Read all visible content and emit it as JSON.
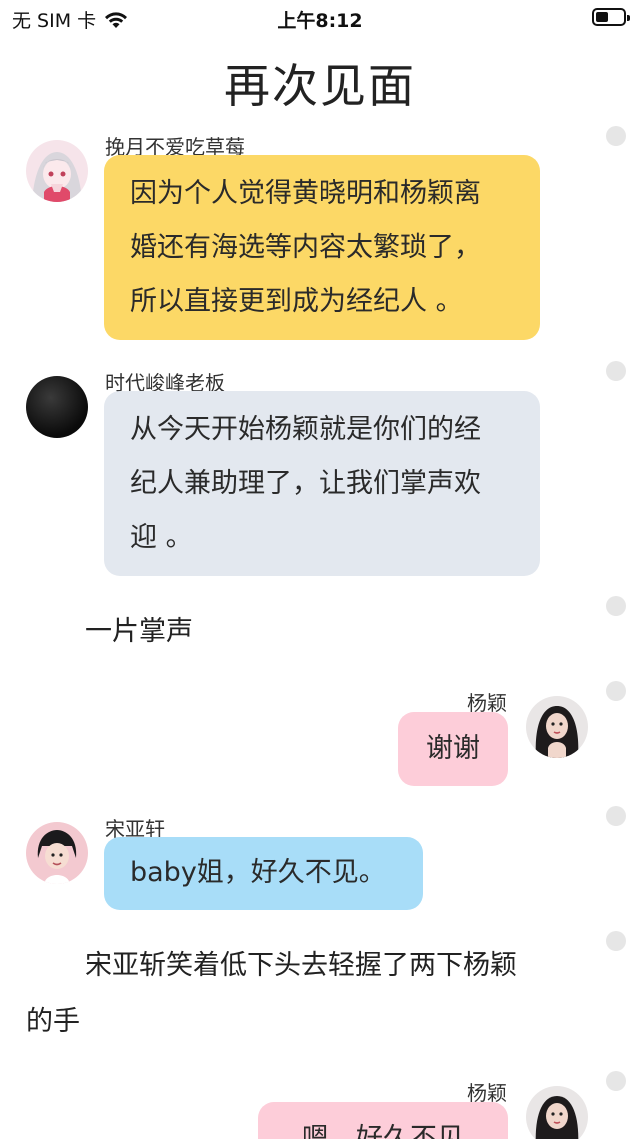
{
  "status_bar": {
    "carrier": "无 SIM 卡",
    "time": "上午8:12",
    "wifi_icon": "wifi-icon",
    "battery_icon": "battery-icon"
  },
  "page": {
    "title": "再次见面"
  },
  "messages": [
    {
      "sender": "挽月不爱吃草莓",
      "avatar": "avatar-anime-girl",
      "text_lines": [
        "因为个人觉得黄晓明和杨颖离",
        "婚还有海选等内容太繁琐了，",
        "所以直接更到成为经纪人 。"
      ],
      "color": "#fcd866",
      "side": "left"
    },
    {
      "sender": "时代峻峰老板",
      "avatar": "avatar-black-circle",
      "text_lines": [
        "从今天开始杨颖就是你们的经",
        "纪人兼助理了，让我们掌声欢",
        "迎 。"
      ],
      "color": "#e3e8ef",
      "side": "left"
    },
    {
      "type": "narration",
      "text": "一片掌声"
    },
    {
      "sender": "杨颖",
      "avatar": "avatar-woman-portrait",
      "text_lines": [
        "谢谢"
      ],
      "color": "#fdcdd9",
      "side": "right"
    },
    {
      "sender": "宋亚轩",
      "avatar": "avatar-boy-portrait",
      "text_lines": [
        "baby姐，好久不见。"
      ],
      "color": "#a8ddf8",
      "side": "left"
    },
    {
      "type": "narration",
      "text_lines": [
        "宋亚斩笑着低下头去轻握了两下杨颖",
        "的手"
      ]
    },
    {
      "sender": "杨颖",
      "avatar": "avatar-woman-portrait",
      "text_lines": [
        "嗯，好久不见"
      ],
      "color": "#fdcdd9",
      "side": "right"
    }
  ]
}
